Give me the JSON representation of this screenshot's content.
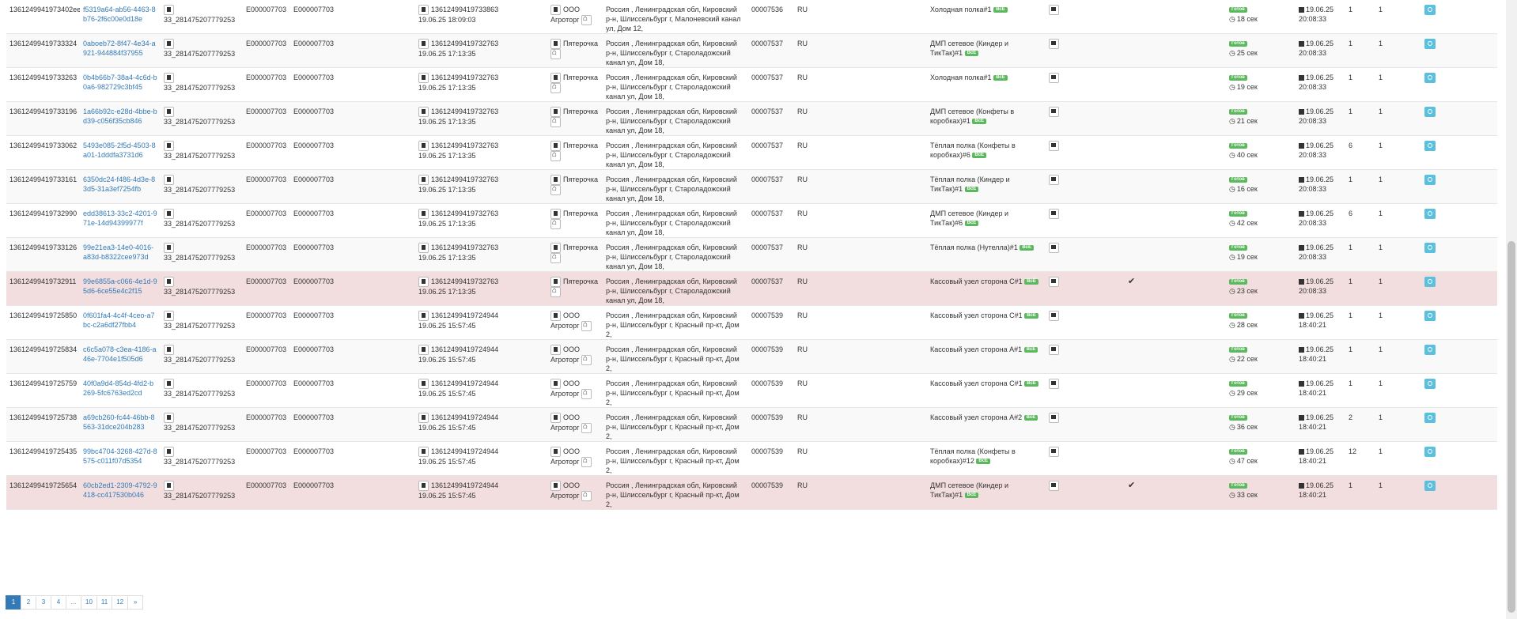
{
  "status_label": "Готов",
  "badge_label": "ВсЁ",
  "check_mark": "✔",
  "rows": [
    {
      "id": "1361249941973402ee4",
      "uuid": "f5319a64-ab56-4463-8b76-2f6c00e0d18e",
      "code": "33_281475207779253",
      "e1": "E000007703",
      "e2": "E000007703",
      "task": "13612499419733863",
      "dt": "19.06.25 18:09:03",
      "store": "ООО Агроторг",
      "addr": "Россия , Ленинградская обл, Кировский р-н, Шлиссельбург г, Малоневский канал ул, Дом 12,",
      "store_code": "00007536",
      "country": "RU",
      "shelf": "Холодная полка#1",
      "check": "",
      "time": "18 сек",
      "date": "19.06.25",
      "clock": "20:08:33",
      "n1": "1",
      "n2": "1",
      "style": "even"
    },
    {
      "id": "13612499419733324",
      "uuid": "0aboeb72-8f47-4e34-a921-944884f37955",
      "code": "33_281475207779253",
      "e1": "E000007703",
      "e2": "E000007703",
      "task": "13612499419732763",
      "dt": "19.06.25 17:13:35",
      "store": "Пятерочка",
      "addr": "Россия , Ленинградская обл, Кировский р-н, Шлиссельбург г, Староладожский канал ул, Дом 18,",
      "store_code": "00007537",
      "country": "RU",
      "shelf": "ДМП сетевое (Киндер и ТикТак)#1",
      "check": "",
      "time": "25 сек",
      "date": "19.06.25",
      "clock": "20:08:33",
      "n1": "1",
      "n2": "1",
      "style": "odd"
    },
    {
      "id": "13612499419733263",
      "uuid": "0b4b66b7-38a4-4c6d-b0a6-982729c3bf45",
      "code": "33_281475207779253",
      "e1": "E000007703",
      "e2": "E000007703",
      "task": "13612499419732763",
      "dt": "19.06.25 17:13:35",
      "store": "Пятерочка",
      "addr": "Россия , Ленинградская обл, Кировский р-н, Шлиссельбург г, Староладожский канал ул, Дом 18,",
      "store_code": "00007537",
      "country": "RU",
      "shelf": "Холодная полка#1",
      "check": "",
      "time": "19 сек",
      "date": "19.06.25",
      "clock": "20:08:33",
      "n1": "1",
      "n2": "1",
      "style": "even"
    },
    {
      "id": "13612499419733196",
      "uuid": "1a66b92c-e28d-4bbe-bd39-c056f35cb846",
      "code": "33_281475207779253",
      "e1": "E000007703",
      "e2": "E000007703",
      "task": "13612499419732763",
      "dt": "19.06.25 17:13:35",
      "store": "Пятерочка",
      "addr": "Россия , Ленинградская обл, Кировский р-н, Шлиссельбург г, Староладожский канал ул, Дом 18,",
      "store_code": "00007537",
      "country": "RU",
      "shelf": "ДМП сетевое (Конфеты в коробках)#1",
      "check": "",
      "time": "21 сек",
      "date": "19.06.25",
      "clock": "20:08:33",
      "n1": "1",
      "n2": "1",
      "style": "odd"
    },
    {
      "id": "13612499419733062",
      "uuid": "5493e085-2f5d-4503-8a01-1dddfa3731d6",
      "code": "33_281475207779253",
      "e1": "E000007703",
      "e2": "E000007703",
      "task": "13612499419732763",
      "dt": "19.06.25 17:13:35",
      "store": "Пятерочка",
      "addr": "Россия , Ленинградская обл, Кировский р-н, Шлиссельбург г, Староладожский канал ул, Дом 18,",
      "store_code": "00007537",
      "country": "RU",
      "shelf": "Тёплая полка (Конфеты в коробках)#6",
      "check": "",
      "time": "40 сек",
      "date": "19.06.25",
      "clock": "20:08:33",
      "n1": "6",
      "n2": "1",
      "style": "even"
    },
    {
      "id": "13612499419733161",
      "uuid": "6350dc24-f486-4d3e-83d5-31a3ef7254fb",
      "code": "33_281475207779253",
      "e1": "E000007703",
      "e2": "E000007703",
      "task": "13612499419732763",
      "dt": "19.06.25 17:13:35",
      "store": "Пятерочка",
      "addr": "Россия , Ленинградская обл, Кировский р-н, Шлиссельбург г, Староладожский канал ул, Дом 18,",
      "store_code": "00007537",
      "country": "RU",
      "shelf": "Тёплая полка (Киндер и ТикТак)#1",
      "check": "",
      "time": "16 сек",
      "date": "19.06.25",
      "clock": "20:08:33",
      "n1": "1",
      "n2": "1",
      "style": "odd"
    },
    {
      "id": "13612499419732990",
      "uuid": "edd38613-33c2-4201-971e-14d94399977f",
      "code": "33_281475207779253",
      "e1": "E000007703",
      "e2": "E000007703",
      "task": "13612499419732763",
      "dt": "19.06.25 17:13:35",
      "store": "Пятерочка",
      "addr": "Россия , Ленинградская обл, Кировский р-н, Шлиссельбург г, Староладожский канал ул, Дом 18,",
      "store_code": "00007537",
      "country": "RU",
      "shelf": "ДМП сетевое (Киндер и ТикТак)#6",
      "check": "",
      "time": "42 сек",
      "date": "19.06.25",
      "clock": "20:08:33",
      "n1": "6",
      "n2": "1",
      "style": "even"
    },
    {
      "id": "13612499419733126",
      "uuid": "99e21ea3-14e0-4016-a83d-b8322cee973d",
      "code": "33_281475207779253",
      "e1": "E000007703",
      "e2": "E000007703",
      "task": "13612499419732763",
      "dt": "19.06.25 17:13:35",
      "store": "Пятерочка",
      "addr": "Россия , Ленинградская обл, Кировский р-н, Шлиссельбург г, Староладожский канал ул, Дом 18,",
      "store_code": "00007537",
      "country": "RU",
      "shelf": "Тёплая полка (Нутелла)#1",
      "check": "",
      "time": "19 сек",
      "date": "19.06.25",
      "clock": "20:08:33",
      "n1": "1",
      "n2": "1",
      "style": "odd"
    },
    {
      "id": "13612499419732911",
      "uuid": "99e6855a-c066-4e1d-95d6-6ce55e4c2f15",
      "code": "33_281475207779253",
      "e1": "E000007703",
      "e2": "E000007703",
      "task": "13612499419732763",
      "dt": "19.06.25 17:13:35",
      "store": "Пятерочка",
      "addr": "Россия , Ленинградская обл, Кировский р-н, Шлиссельбург г, Староладожский канал ул, Дом 18,",
      "store_code": "00007537",
      "country": "RU",
      "shelf": "Кассовый узел сторона С#1",
      "check": "✔",
      "time": "23 сек",
      "date": "19.06.25",
      "clock": "20:08:33",
      "n1": "1",
      "n2": "1",
      "style": "hl"
    },
    {
      "id": "13612499419725850",
      "uuid": "0f601fa4-4c4f-4ceo-a7bc-c2a6df27fbb4",
      "code": "33_281475207779253",
      "e1": "E000007703",
      "e2": "E000007703",
      "task": "13612499419724944",
      "dt": "19.06.25 15:57:45",
      "store": "ООО Агроторг",
      "addr": "Россия , Ленинградская обл, Кировский р-н, Шлиссельбург г, Красный пр-кт, Дом 2,",
      "store_code": "00007539",
      "country": "RU",
      "shelf": "Кассовый узел сторона С#1",
      "check": "",
      "time": "28 сек",
      "date": "19.06.25",
      "clock": "18:40:21",
      "n1": "1",
      "n2": "1",
      "style": "even"
    },
    {
      "id": "13612499419725834",
      "uuid": "c6c5a078-c3ea-4186-a46e-7704e1f505d6",
      "code": "33_281475207779253",
      "e1": "E000007703",
      "e2": "E000007703",
      "task": "13612499419724944",
      "dt": "19.06.25 15:57:45",
      "store": "ООО Агроторг",
      "addr": "Россия , Ленинградская обл, Кировский р-н, Шлиссельбург г, Красный пр-кт, Дом 2,",
      "store_code": "00007539",
      "country": "RU",
      "shelf": "Кассовый узел сторона А#1",
      "check": "",
      "time": "22 сек",
      "date": "19.06.25",
      "clock": "18:40:21",
      "n1": "1",
      "n2": "1",
      "style": "odd"
    },
    {
      "id": "13612499419725759",
      "uuid": "40f0a9d4-854d-4fd2-b269-5fc6763ed2cd",
      "code": "33_281475207779253",
      "e1": "E000007703",
      "e2": "E000007703",
      "task": "13612499419724944",
      "dt": "19.06.25 15:57:45",
      "store": "ООО Агроторг",
      "addr": "Россия , Ленинградская обл, Кировский р-н, Шлиссельбург г, Красный пр-кт, Дом 2,",
      "store_code": "00007539",
      "country": "RU",
      "shelf": "Кассовый узел сторона С#1",
      "check": "",
      "time": "29 сек",
      "date": "19.06.25",
      "clock": "18:40:21",
      "n1": "1",
      "n2": "1",
      "style": "even"
    },
    {
      "id": "13612499419725738",
      "uuid": "a69cb260-fc44-46bb-8563-31dce204b283",
      "code": "33_281475207779253",
      "e1": "E000007703",
      "e2": "E000007703",
      "task": "13612499419724944",
      "dt": "19.06.25 15:57:45",
      "store": "ООО Агроторг",
      "addr": "Россия , Ленинградская обл, Кировский р-н, Шлиссельбург г, Красный пр-кт, Дом 2,",
      "store_code": "00007539",
      "country": "RU",
      "shelf": "Кассовый узел сторона А#2",
      "check": "",
      "time": "36 сек",
      "date": "19.06.25",
      "clock": "18:40:21",
      "n1": "2",
      "n2": "1",
      "style": "odd"
    },
    {
      "id": "13612499419725435",
      "uuid": "99bc4704-3268-427d-8575-c011f07d5354",
      "code": "33_281475207779253",
      "e1": "E000007703",
      "e2": "E000007703",
      "task": "13612499419724944",
      "dt": "19.06.25 15:57:45",
      "store": "ООО Агроторг",
      "addr": "Россия , Ленинградская обл, Кировский р-н, Шлиссельбург г, Красный пр-кт, Дом 2,",
      "store_code": "00007539",
      "country": "RU",
      "shelf": "Тёплая полка (Конфеты в коробках)#12",
      "check": "",
      "time": "47 сек",
      "date": "19.06.25",
      "clock": "18:40:21",
      "n1": "12",
      "n2": "1",
      "style": "even"
    },
    {
      "id": "13612499419725654",
      "uuid": "60cb2ed1-2309-4792-9418-cc417530b046",
      "code": "33_281475207779253",
      "e1": "E000007703",
      "e2": "E000007703",
      "task": "13612499419724944",
      "dt": "19.06.25 15:57:45",
      "store": "ООО Агроторг",
      "addr": "Россия , Ленинградская обл, Кировский р-н, Шлиссельбург г, Красный пр-кт, Дом 2,",
      "store_code": "00007539",
      "country": "RU",
      "shelf": "ДМП сетевое (Киндер и ТикТак)#1",
      "check": "✔",
      "time": "33 сек",
      "date": "19.06.25",
      "clock": "18:40:21",
      "n1": "1",
      "n2": "1",
      "style": "hl"
    }
  ],
  "pagination": {
    "pages": [
      "1",
      "2",
      "3",
      "4",
      "...",
      "10",
      "11",
      "12",
      "»"
    ],
    "active": "1"
  }
}
